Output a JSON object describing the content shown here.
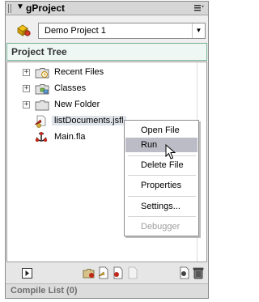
{
  "panel": {
    "title": "gProject",
    "collapse_glyph": "▼",
    "menu_icon": "panel-menu-icon"
  },
  "project": {
    "selected": "Demo Project 1",
    "dropdown_glyph": "▼"
  },
  "tree": {
    "header": "Project Tree",
    "expander_glyph": "+",
    "items": [
      {
        "label": "Recent Files",
        "icon": "recent-folder-icon"
      },
      {
        "label": "Classes",
        "icon": "classes-folder-icon"
      },
      {
        "label": "New Folder",
        "icon": "folder-icon"
      },
      {
        "label": "listDocuments.jsfl",
        "icon": "jsfl-file-icon"
      },
      {
        "label": "Main.fla",
        "icon": "fla-file-icon"
      }
    ]
  },
  "context_menu": {
    "items": [
      {
        "label": "Open File"
      },
      {
        "label": "Run"
      },
      {
        "label": "Delete File"
      },
      {
        "label": "Properties"
      },
      {
        "label": "Settings..."
      },
      {
        "label": "Debugger"
      }
    ]
  },
  "compile": {
    "label": "Compile List (0)"
  },
  "colors": {
    "header_border": "#7cb79a",
    "header_bg": "#eef7f3",
    "menu_highlight": "#bcbcc6",
    "selection_bg": "#dfe3ea"
  }
}
